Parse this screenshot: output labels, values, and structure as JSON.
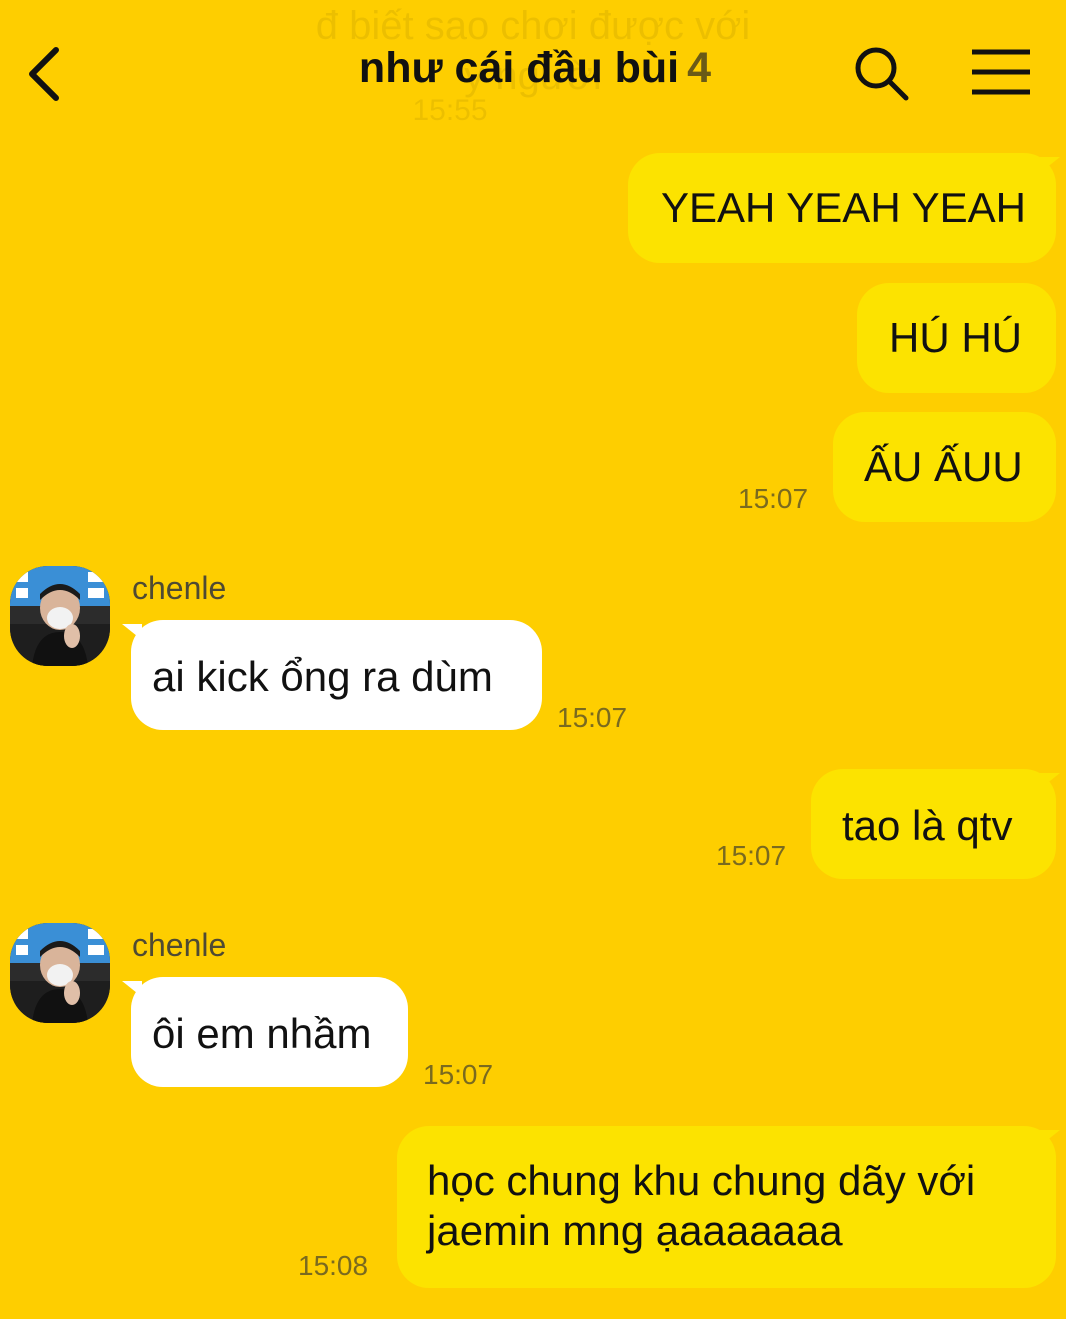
{
  "header": {
    "title": "như cái đầu bùi",
    "member_count": "4",
    "ghost_line1": "đ biết sao chơi được với",
    "ghost_line2": "y người",
    "ghost_time": "15:55"
  },
  "messages": [
    {
      "id": "m1",
      "side": "me",
      "text": "YEAH YEAH YEAH"
    },
    {
      "id": "m2",
      "side": "me",
      "text": "HÚ HÚ"
    },
    {
      "id": "m3",
      "side": "me",
      "text": "ẤU ẤUU",
      "time": "15:07"
    },
    {
      "id": "m4",
      "side": "other",
      "sender": "chenle",
      "text": "ai kick ổng ra dùm",
      "time": "15:07"
    },
    {
      "id": "m5",
      "side": "me",
      "text": "tao là qtv",
      "time": "15:07"
    },
    {
      "id": "m6",
      "side": "other",
      "sender": "chenle",
      "text": "ôi em nhầm",
      "time": "15:07"
    },
    {
      "id": "m7",
      "side": "me",
      "text_line1": "học chung khu chung dãy với",
      "text_line2": "jaemin mng ạaaaaaaa",
      "time": "15:08"
    }
  ],
  "colors": {
    "background": "#FECE00",
    "my_bubble": "#FCE300",
    "other_bubble": "#FFFFFF",
    "time_text": "#7A6A1F"
  },
  "icons": {
    "back": "chevron-left-icon",
    "search": "search-icon",
    "menu": "hamburger-menu-icon"
  }
}
